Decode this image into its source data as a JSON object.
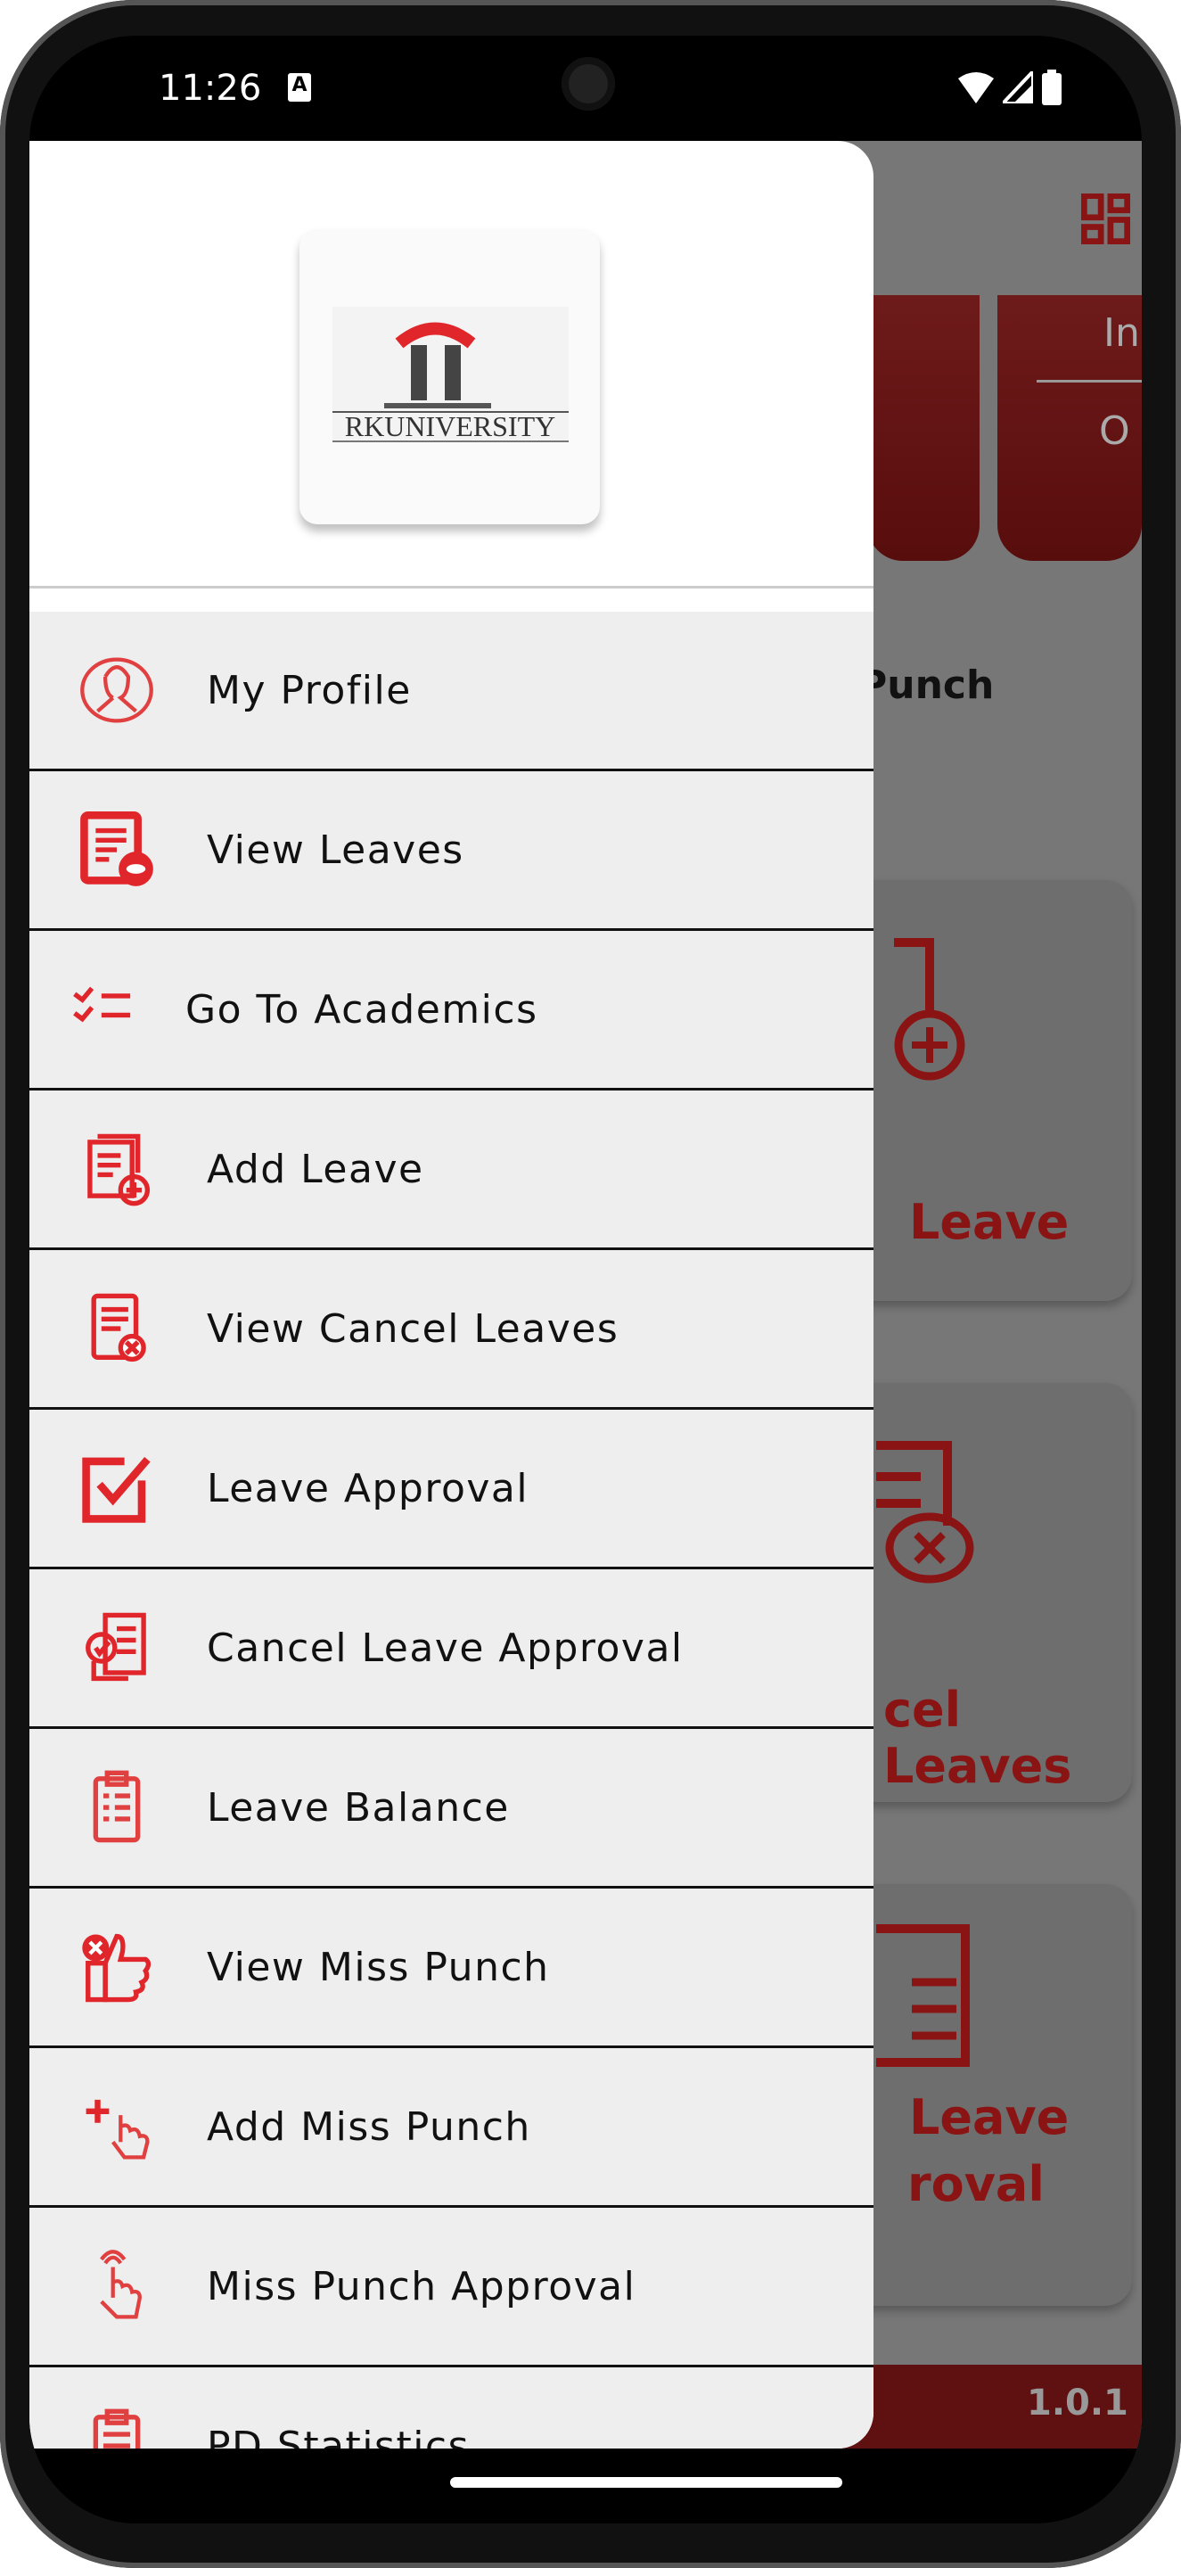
{
  "status_bar": {
    "time": "11:26",
    "notification_icon": "A",
    "icons": [
      "wifi-icon",
      "signal-icon",
      "battery-icon"
    ]
  },
  "background": {
    "header_in": "In",
    "header_o": "O",
    "punch_label": "Punch",
    "cards": [
      {
        "label": "Leave"
      },
      {
        "label": "cel Leaves"
      },
      {
        "label_line1": "Leave",
        "label_line2": "roval"
      }
    ],
    "version": "1.0.1"
  },
  "drawer": {
    "logo_text": "RKUNIVERSITY",
    "items": [
      {
        "label": "My Profile",
        "icon": "profile-icon"
      },
      {
        "label": "View Leaves",
        "icon": "view-document-icon"
      },
      {
        "label": "Go To Academics",
        "icon": "checklist-icon"
      },
      {
        "label": "Add Leave",
        "icon": "add-document-icon"
      },
      {
        "label": "View Cancel Leaves",
        "icon": "cancel-document-icon"
      },
      {
        "label": "Leave Approval",
        "icon": "checkbox-icon"
      },
      {
        "label": "Cancel Leave Approval",
        "icon": "approval-document-icon"
      },
      {
        "label": "Leave Balance",
        "icon": "clipboard-icon"
      },
      {
        "label": "View Miss Punch",
        "icon": "thumbs-up-icon"
      },
      {
        "label": "Add Miss Punch",
        "icon": "add-touch-icon"
      },
      {
        "label": "Miss Punch Approval",
        "icon": "touch-icon"
      },
      {
        "label": "PD Statistics",
        "icon": "clipboard-icon"
      }
    ]
  },
  "colors": {
    "accent": "#e0262b",
    "dark_red": "#5f1010",
    "scrim": "#777777"
  }
}
